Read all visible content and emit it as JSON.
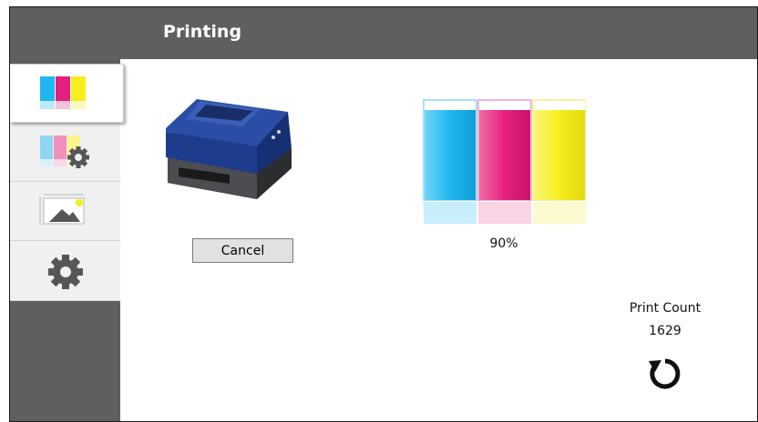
{
  "header": {
    "title": "Printing"
  },
  "sidebar": {
    "items": [
      {
        "icon": "ink-status-icon",
        "active": true
      },
      {
        "icon": "ink-settings-icon",
        "active": false
      },
      {
        "icon": "image-icon",
        "active": false
      },
      {
        "icon": "gear-icon",
        "active": false
      }
    ]
  },
  "main": {
    "cancel_label": "Cancel",
    "ink_level": "90%",
    "print_count_label": "Print Count",
    "print_count_value": "1629"
  },
  "colors": {
    "header_bg": "#5e5f61",
    "cyan": "#1fb7ee",
    "magenta": "#e6207c",
    "yellow": "#f6ee1d",
    "printer_blue": "#1e3c8c"
  }
}
